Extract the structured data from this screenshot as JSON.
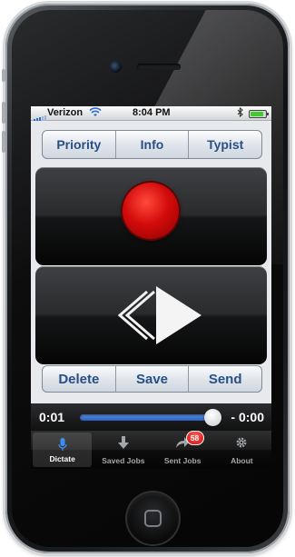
{
  "status_bar": {
    "carrier": "Verizon",
    "time": "8:04 PM",
    "icons": [
      "signal-bars-icon",
      "wifi-icon",
      "bluetooth-icon",
      "battery-icon"
    ],
    "battery_level": 0.85
  },
  "top_segment": {
    "items": [
      {
        "label": "Priority"
      },
      {
        "label": "Info"
      },
      {
        "label": "Typist"
      }
    ]
  },
  "record_panel": {
    "icon": "record-icon",
    "color": "#d30b0b"
  },
  "play_panel": {
    "rewind_icon": "rewind-chevron-icon",
    "play_icon": "play-icon"
  },
  "actions": {
    "items": [
      {
        "label": "Delete"
      },
      {
        "label": "Save"
      },
      {
        "label": "Send"
      }
    ]
  },
  "player": {
    "elapsed": "0:01",
    "remaining": "- 0:00",
    "progress": 0.95
  },
  "tabbar": {
    "tabs": [
      {
        "label": "Dictate",
        "icon": "microphone-icon",
        "active": true
      },
      {
        "label": "Saved Jobs",
        "icon": "download-arrow-icon",
        "active": false
      },
      {
        "label": "Sent Jobs",
        "icon": "sent-arrow-icon",
        "active": false,
        "badge": "58"
      },
      {
        "label": "About",
        "icon": "gear-icon",
        "active": false
      }
    ]
  },
  "colors": {
    "segment_text": "#284f86",
    "accent_blue": "#2b64c6",
    "badge_red": "#d40e0e"
  }
}
